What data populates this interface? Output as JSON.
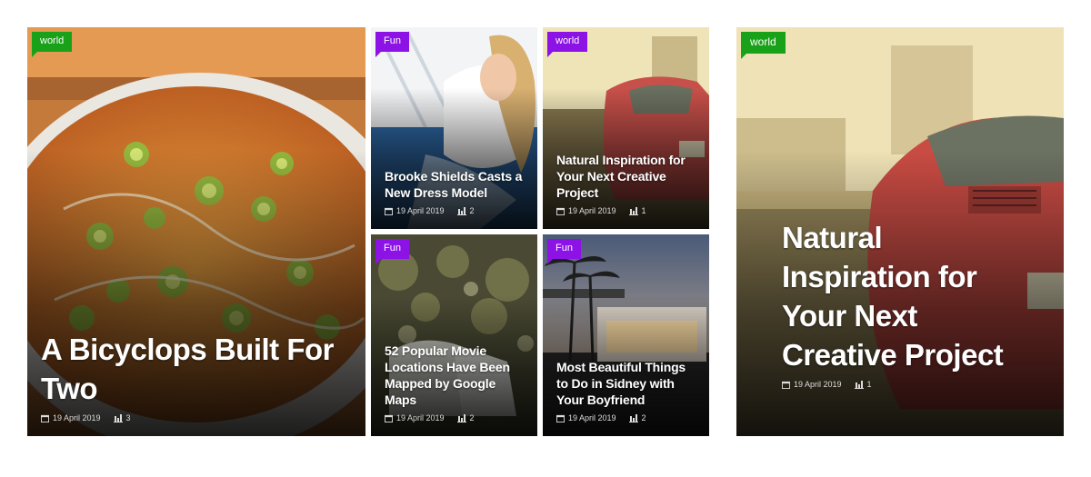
{
  "posts": [
    {
      "category": "world",
      "title": "A Bicyclops Built For Two",
      "date": "19 April 2019",
      "views": "3",
      "colors": {
        "badge": "#1aa11a"
      }
    },
    {
      "category": "Fun",
      "title": "Brooke Shields Casts a New Dress Model",
      "date": "19 April 2019",
      "views": "2",
      "colors": {
        "badge": "#8c12e6"
      }
    },
    {
      "category": "world",
      "title": "Natural Inspiration for Your Next Creative Project",
      "date": "19 April 2019",
      "views": "1",
      "colors": {
        "badge": "#8c12e6"
      }
    },
    {
      "category": "Fun",
      "title": "52 Popular Movie Locations Have Been Mapped by Google Maps",
      "date": "19 April 2019",
      "views": "2",
      "colors": {
        "badge": "#8c12e6"
      }
    },
    {
      "category": "Fun",
      "title": "Most Beautiful Things to Do in Sidney with Your Boyfriend",
      "date": "19 April 2019",
      "views": "2",
      "colors": {
        "badge": "#8c12e6"
      }
    },
    {
      "category": "world",
      "title": "Natural Inspiration for Your Next Creative Project",
      "date": "19 April 2019",
      "views": "1",
      "colors": {
        "badge": "#1aa11a"
      }
    }
  ],
  "icons": {
    "date": "calendar-icon",
    "views": "bar-chart-icon"
  }
}
